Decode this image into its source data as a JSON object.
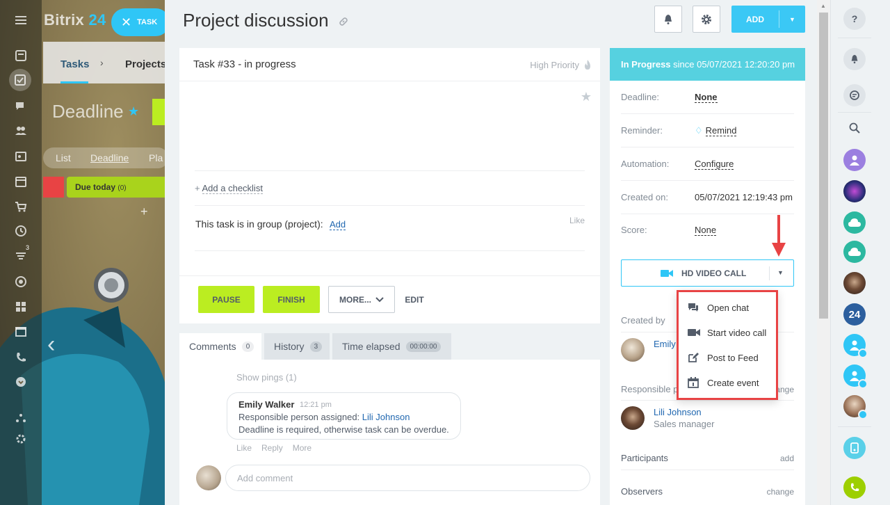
{
  "background": {
    "brand_name": "Bitrix",
    "brand_num": "24",
    "task_pill": "TASK",
    "nav_tab_active": "Tasks",
    "nav_tab_other": "Projects",
    "page_title": "Deadline",
    "views": [
      "List",
      "Deadline",
      "Pla"
    ],
    "due_today": "Due today",
    "due_count": "(0)",
    "counter_badge": "3"
  },
  "header": {
    "title": "Project discussion",
    "add_label": "ADD"
  },
  "task": {
    "status_title": "Task #33 - in progress",
    "priority_label": "High Priority",
    "add_checklist_prefix": "+",
    "add_checklist": "Add a checklist",
    "group_text": "This task is in group (project):",
    "group_add": "Add",
    "like": "Like",
    "actions": {
      "pause": "PAUSE",
      "finish": "FINISH",
      "more": "MORE...",
      "edit": "EDIT"
    }
  },
  "tabs": [
    {
      "label": "Comments",
      "count": "0"
    },
    {
      "label": "History",
      "count": "3"
    },
    {
      "label": "Time elapsed",
      "count": "00:00:00"
    }
  ],
  "comments": {
    "show_pings": "Show pings (1)",
    "items": [
      {
        "author": "Emily Walker",
        "time": "12:21 pm",
        "line1_prefix": "Responsible person assigned:",
        "line1_link": "Lili Johnson",
        "line2": "Deadline is required, otherwise task can be overdue."
      }
    ],
    "actions": [
      "Like",
      "Reply",
      "More"
    ],
    "add_placeholder": "Add comment"
  },
  "sidebar": {
    "status_bold": "In Progress",
    "status_rest": "since 05/07/2021 12:20:20 pm",
    "rows": [
      {
        "key": "Deadline:",
        "value": "None"
      },
      {
        "key": "Reminder:",
        "value": "Remind"
      },
      {
        "key": "Automation:",
        "value": "Configure"
      },
      {
        "key": "Created on:",
        "value": "05/07/2021 12:19:43 pm"
      },
      {
        "key": "Score:",
        "value": "None"
      }
    ],
    "video_call": "HD VIDEO CALL",
    "created_by": "Created by",
    "creator_name": "Emily",
    "responsible": "Responsible p",
    "responsible_change": "change",
    "responsible_name": "Lili Johnson",
    "responsible_role": "Sales manager",
    "participants": "Participants",
    "participants_action": "add",
    "observers": "Observers",
    "observers_action": "change"
  },
  "video_menu": {
    "items": [
      {
        "label": "Open chat",
        "icon": "chat-icon"
      },
      {
        "label": "Start video call",
        "icon": "video-camera-icon"
      },
      {
        "label": "Post to Feed",
        "icon": "edit-icon"
      },
      {
        "label": "Create event",
        "icon": "calendar-icon"
      }
    ]
  },
  "right_rail": {
    "bitrix_badge": "24"
  },
  "colors": {
    "accent": "#2fc6f6",
    "status_header": "#56d1e0",
    "action_green": "#bbed21",
    "highlight_red": "#e84344",
    "link_blue": "#2067b0"
  }
}
